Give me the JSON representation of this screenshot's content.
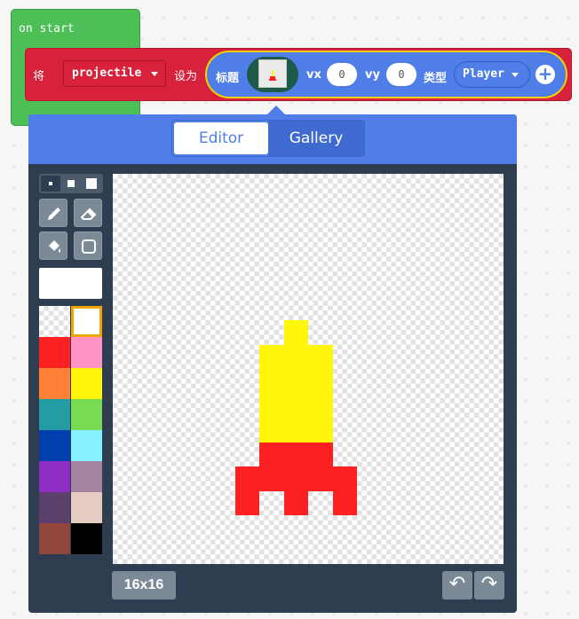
{
  "on_start": {
    "label": "on start"
  },
  "set_block": {
    "word_set": "将",
    "variable": "projectile",
    "word_to": "设为",
    "sprite": {
      "label_image": "标题",
      "label_vx": "vx",
      "vx": "0",
      "label_vy": "vy",
      "vy": "0",
      "label_kind": "类型",
      "kind": "Player"
    }
  },
  "editor": {
    "tabs": {
      "editor": "Editor",
      "gallery": "Gallery"
    },
    "size_label": "16x16",
    "palette": [
      "transparent",
      "#ffffff",
      "#ff2121",
      "#ff93c4",
      "#ff8135",
      "#fff609",
      "#249ca3",
      "#78dc52",
      "#003fad",
      "#87f2ff",
      "#8e2ec4",
      "#a4839f",
      "#5c406c",
      "#e5cdc4",
      "#91463d",
      "#000000"
    ],
    "selected_color": "#ffffff",
    "sprite_pixels": [
      "................",
      "................",
      "................",
      "................",
      "................",
      "................",
      ".......5........",
      "......555.......",
      "......555.......",
      "......555.......",
      "......555.......",
      "......222.......",
      ".....22222......",
      ".....2.2.2......",
      "................",
      "................"
    ]
  }
}
